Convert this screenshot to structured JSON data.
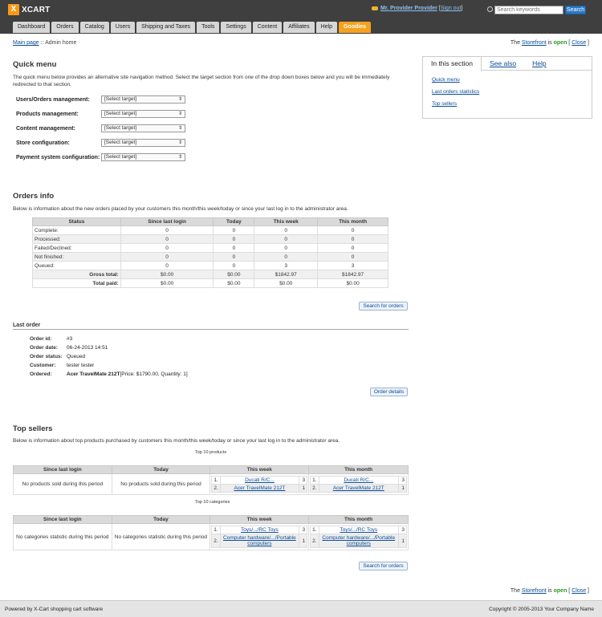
{
  "brand": {
    "mark": "X",
    "name": "XCART"
  },
  "header": {
    "provider_name": "Mr. Provider Provider",
    "sign_out": "Sign out",
    "search_placeholder": "Search keywords",
    "search_button": "Search"
  },
  "tabs": [
    "Dashboard",
    "Orders",
    "Catalog",
    "Users",
    "Shipping and Taxes",
    "Tools",
    "Settings",
    "Content",
    "Affiliates",
    "Help",
    "Goodies"
  ],
  "breadcrumb": {
    "main": "Main page",
    "sep": " :: ",
    "current": "Admin home"
  },
  "storefront": {
    "prefix": "The ",
    "link": "Storefront",
    "is": " is ",
    "status": "open",
    "bracket_open": " [ ",
    "close": "Close",
    "bracket_close": " ]"
  },
  "quick_menu": {
    "title": "Quick menu",
    "description": "The quick menu below provides an alternative site navigation method. Select the target section from one of the drop down boxes below and you will be immediately redirected to that section.",
    "rows": [
      {
        "label": "Users/Orders management:",
        "value": "[Select target]"
      },
      {
        "label": "Products management:",
        "value": "[Select target]"
      },
      {
        "label": "Content management:",
        "value": "[Select target]"
      },
      {
        "label": "Store configuration:",
        "value": "[Select target]"
      },
      {
        "label": "Payment system configuration:",
        "value": "[Select target]"
      }
    ]
  },
  "side_panel": {
    "tabs": [
      "In this section",
      "See also",
      "Help"
    ],
    "links": [
      "Quick menu",
      "Last orders statistics",
      "Top sellers"
    ]
  },
  "orders_info": {
    "title": "Orders info",
    "description": "Below is information about the new orders placed by your customers this month/this week/today or since your last log in to the administrator area.",
    "columns": [
      "Status",
      "Since last login",
      "Today",
      "This week",
      "This month"
    ],
    "rows": [
      [
        "Complete:",
        "0",
        "0",
        "0",
        "0"
      ],
      [
        "Processed:",
        "0",
        "0",
        "0",
        "0"
      ],
      [
        "Failed/Declined:",
        "0",
        "0",
        "0",
        "0"
      ],
      [
        "Not finished:",
        "0",
        "0",
        "0",
        "0"
      ],
      [
        "Queued:",
        "0",
        "0",
        "3",
        "3"
      ]
    ],
    "totals": [
      [
        "Gross total:",
        "$0.00",
        "$0.00",
        "$1842.97",
        "$1842.97"
      ],
      [
        "Total paid:",
        "$0.00",
        "$0.00",
        "$0.00",
        "$0.00"
      ]
    ],
    "search_button": "Search for orders"
  },
  "last_order": {
    "title": "Last order",
    "fields": [
      {
        "label": "Order id:",
        "value": "#3"
      },
      {
        "label": "Order date:",
        "value": "06-24-2013 14:51"
      },
      {
        "label": "Order status:",
        "value": "Queued"
      },
      {
        "label": "Customer:",
        "value": "tester tester"
      }
    ],
    "ordered_label": "Ordered:",
    "ordered_product": "Acer TravelMate 212T",
    "ordered_details": " [Price: $1790.00, Quantity: 1]",
    "details_button": "Order details"
  },
  "top_sellers": {
    "title": "Top sellers",
    "description": "Below is information about top products purchased by customers this month/this week/today or since your last log in to the administrator area.",
    "products_caption": "Top 10 products",
    "categories_caption": "Top 10 categories",
    "columns": [
      "Since last login",
      "Today",
      "This week",
      "This month"
    ],
    "no_products": "No products sold during this period",
    "no_categories": "No categories statistic during this period",
    "products_week": [
      {
        "n": "1.",
        "name": "Ducati R/C...",
        "count": "3"
      },
      {
        "n": "2.",
        "name": "Acer TravelMate 212T",
        "count": "1"
      }
    ],
    "products_month": [
      {
        "n": "1.",
        "name": "Ducati R/C...",
        "count": "3"
      },
      {
        "n": "2.",
        "name": "Acer TravelMate 212T",
        "count": "1"
      }
    ],
    "categories_week": [
      {
        "n": "1.",
        "name": "Toys/.../RC Toys",
        "count": "3"
      },
      {
        "n": "2.",
        "name": "Computer hardware/.../Portable computers",
        "count": "1"
      }
    ],
    "categories_month": [
      {
        "n": "1.",
        "name": "Toys/.../RC Toys",
        "count": "3"
      },
      {
        "n": "2.",
        "name": "Computer hardware/.../Portable computers",
        "count": "1"
      }
    ],
    "search_button": "Search for orders"
  },
  "footer": {
    "left": "Powered by X-Cart shopping cart software",
    "right": "Copyright © 2005-2013 Your Company Name"
  }
}
